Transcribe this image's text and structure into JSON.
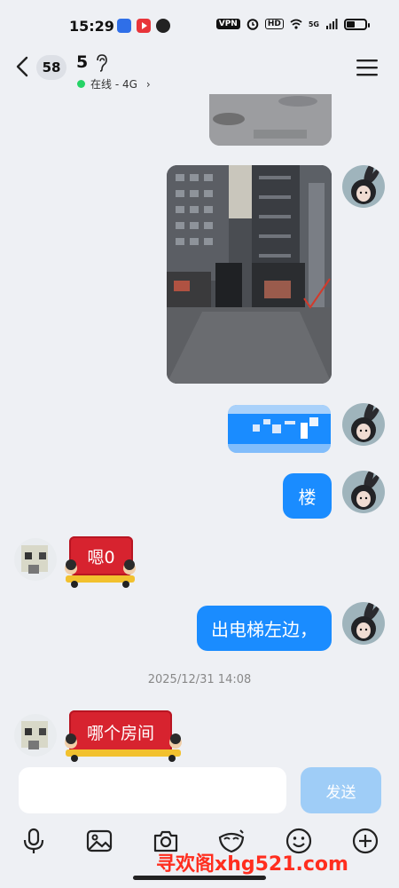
{
  "status_bar": {
    "time": "15:29",
    "vpn": "VPN",
    "hd": "HD",
    "network": "5G",
    "app_icons": [
      "app-icon-blue",
      "video-play-icon",
      "alarm-app-icon"
    ]
  },
  "header": {
    "unread_count": "58",
    "contact_name": "5",
    "status_text": "在线 - 4G",
    "status_color": "#25d366"
  },
  "messages": [
    {
      "from": "me",
      "type": "image"
    },
    {
      "from": "me",
      "type": "image"
    },
    {
      "from": "me",
      "type": "text-blurred"
    },
    {
      "from": "me",
      "type": "text",
      "text": "楼"
    },
    {
      "from": "other",
      "type": "sticker-text",
      "text": "嗯0"
    },
    {
      "from": "me",
      "type": "text",
      "text": "出电梯左边，"
    },
    {
      "from": "other",
      "type": "sticker-text",
      "text": "哪个房间"
    }
  ],
  "chat": {
    "timestamp": "2025/12/31 14:08",
    "bubble_color": "#1a8cff",
    "sticker_color": "#d7232f"
  },
  "input": {
    "placeholder": "",
    "value": "",
    "send_label": "发送"
  },
  "toolbar": [
    "microphone-icon",
    "image-icon",
    "camera-icon",
    "sticker-mask-icon",
    "emoji-icon",
    "plus-icon"
  ],
  "watermark": "寻欢阁xhg521.com"
}
